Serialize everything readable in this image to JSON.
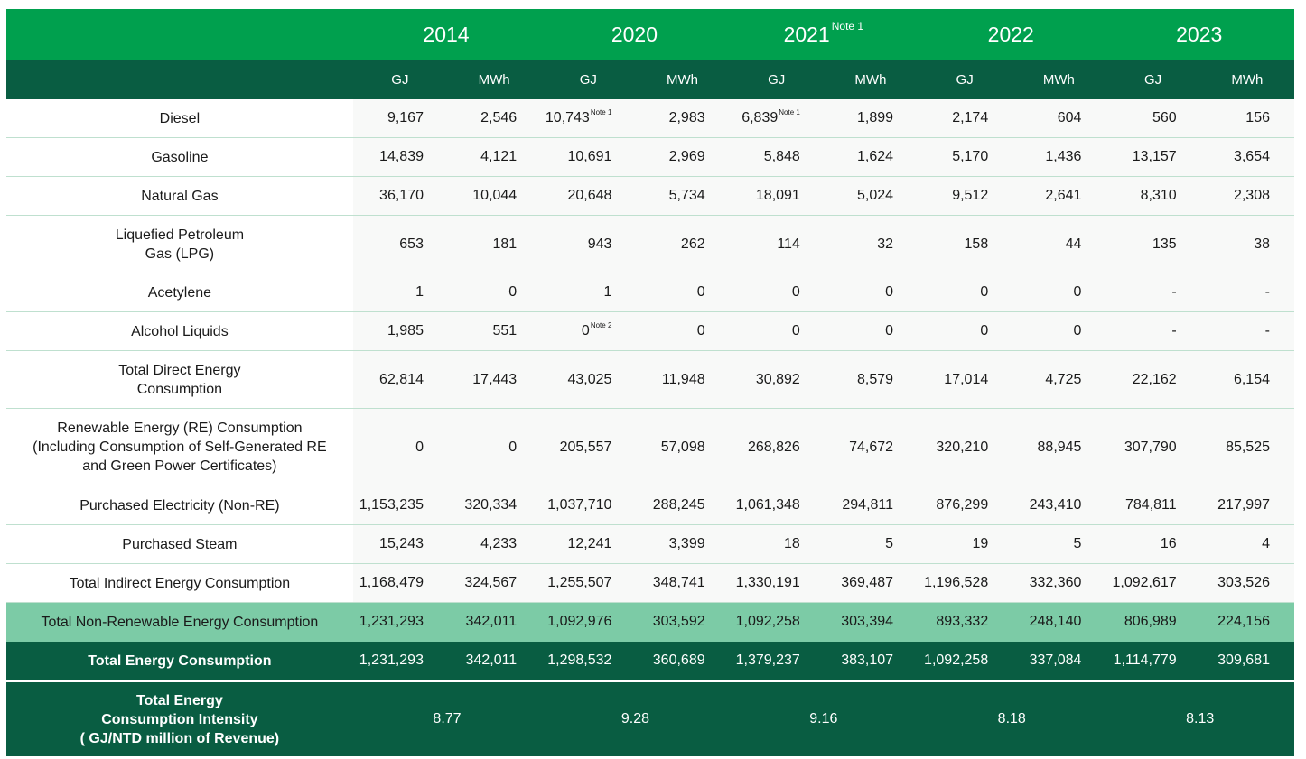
{
  "header": {
    "years": [
      {
        "label": "2014",
        "note": ""
      },
      {
        "label": "2020",
        "note": ""
      },
      {
        "label": "2021",
        "note": "Note 1"
      },
      {
        "label": "2022",
        "note": ""
      },
      {
        "label": "2023",
        "note": ""
      }
    ],
    "units": [
      "GJ",
      "MWh",
      "GJ",
      "MWh",
      "GJ",
      "MWh",
      "GJ",
      "MWh",
      "GJ",
      "MWh"
    ]
  },
  "rows": [
    {
      "label": [
        "Diesel"
      ],
      "values": [
        "9,167",
        "2,546",
        "10,743",
        "2,983",
        "6,839",
        "1,899",
        "2,174",
        "604",
        "560",
        "156"
      ],
      "notes": [
        "",
        "",
        "Note 1",
        "",
        "Note 1",
        "",
        "",
        "",
        "",
        ""
      ]
    },
    {
      "label": [
        "Gasoline"
      ],
      "values": [
        "14,839",
        "4,121",
        "10,691",
        "2,969",
        "5,848",
        "1,624",
        "5,170",
        "1,436",
        "13,157",
        "3,654"
      ],
      "notes": [
        "",
        "",
        "",
        "",
        "",
        "",
        "",
        "",
        "",
        ""
      ]
    },
    {
      "label": [
        "Natural Gas"
      ],
      "values": [
        "36,170",
        "10,044",
        "20,648",
        "5,734",
        "18,091",
        "5,024",
        "9,512",
        "2,641",
        "8,310",
        "2,308"
      ],
      "notes": [
        "",
        "",
        "",
        "",
        "",
        "",
        "",
        "",
        "",
        ""
      ]
    },
    {
      "label": [
        "Liquefied Petroleum",
        "Gas (LPG)"
      ],
      "values": [
        "653",
        "181",
        "943",
        "262",
        "114",
        "32",
        "158",
        "44",
        "135",
        "38"
      ],
      "notes": [
        "",
        "",
        "",
        "",
        "",
        "",
        "",
        "",
        "",
        ""
      ]
    },
    {
      "label": [
        "Acetylene"
      ],
      "values": [
        "1",
        "0",
        "1",
        "0",
        "0",
        "0",
        "0",
        "0",
        "-",
        "-"
      ],
      "notes": [
        "",
        "",
        "",
        "",
        "",
        "",
        "",
        "",
        "",
        ""
      ]
    },
    {
      "label": [
        "Alcohol Liquids"
      ],
      "values": [
        "1,985",
        "551",
        "0",
        "0",
        "0",
        "0",
        "0",
        "0",
        "-",
        "-"
      ],
      "notes": [
        "",
        "",
        "Note 2",
        "",
        "",
        "",
        "",
        "",
        "",
        ""
      ]
    },
    {
      "label": [
        "Total Direct Energy",
        "Consumption"
      ],
      "values": [
        "62,814",
        "17,443",
        "43,025",
        "11,948",
        "30,892",
        "8,579",
        "17,014",
        "4,725",
        "22,162",
        "6,154"
      ],
      "notes": [
        "",
        "",
        "",
        "",
        "",
        "",
        "",
        "",
        "",
        ""
      ]
    },
    {
      "label": [
        "Renewable Energy (RE) Consumption",
        "(Including Consumption of Self-Generated RE",
        "and Green Power Certificates)"
      ],
      "values": [
        "0",
        "0",
        "205,557",
        "57,098",
        "268,826",
        "74,672",
        "320,210",
        "88,945",
        "307,790",
        "85,525"
      ],
      "notes": [
        "",
        "",
        "",
        "",
        "",
        "",
        "",
        "",
        "",
        ""
      ]
    },
    {
      "label": [
        "Purchased Electricity (Non-RE)"
      ],
      "values": [
        "1,153,235",
        "320,334",
        "1,037,710",
        "288,245",
        "1,061,348",
        "294,811",
        "876,299",
        "243,410",
        "784,811",
        "217,997"
      ],
      "notes": [
        "",
        "",
        "",
        "",
        "",
        "",
        "",
        "",
        "",
        ""
      ]
    },
    {
      "label": [
        "Purchased Steam"
      ],
      "values": [
        "15,243",
        "4,233",
        "12,241",
        "3,399",
        "18",
        "5",
        "19",
        "5",
        "16",
        "4"
      ],
      "notes": [
        "",
        "",
        "",
        "",
        "",
        "",
        "",
        "",
        "",
        ""
      ]
    },
    {
      "label": [
        "Total Indirect Energy Consumption"
      ],
      "values": [
        "1,168,479",
        "324,567",
        "1,255,507",
        "348,741",
        "1,330,191",
        "369,487",
        "1,196,528",
        "332,360",
        "1,092,617",
        "303,526"
      ],
      "notes": [
        "",
        "",
        "",
        "",
        "",
        "",
        "",
        "",
        "",
        ""
      ]
    },
    {
      "label": [
        "Total Non-Renewable Energy Consumption"
      ],
      "values": [
        "1,231,293",
        "342,011",
        "1,092,976",
        "303,592",
        "1,092,258",
        "303,394",
        "893,332",
        "248,140",
        "806,989",
        "224,156"
      ],
      "notes": [
        "",
        "",
        "",
        "",
        "",
        "",
        "",
        "",
        "",
        ""
      ]
    },
    {
      "label": [
        "Total Energy Consumption"
      ],
      "values": [
        "1,231,293",
        "342,011",
        "1,298,532",
        "360,689",
        "1,379,237",
        "383,107",
        "1,092,258",
        "337,084",
        "1,114,779",
        "309,681"
      ],
      "notes": [
        "",
        "",
        "",
        "",
        "",
        "",
        "",
        "",
        "",
        ""
      ]
    }
  ],
  "intensity": {
    "label": [
      "Total Energy",
      "Consumption Intensity",
      "( GJ/NTD million of Revenue)"
    ],
    "values": [
      "8.77",
      "9.28",
      "9.16",
      "8.18",
      "8.13"
    ]
  },
  "colors": {
    "header_green": "#00a04e",
    "dark_green": "#095d42",
    "highlight_green": "#7ccba6"
  }
}
